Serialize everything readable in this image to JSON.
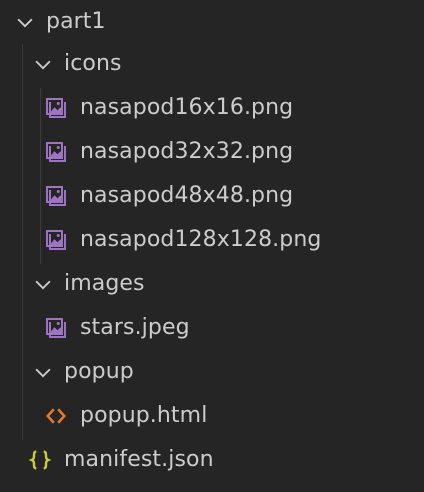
{
  "explorer": {
    "root": {
      "label": "part1",
      "expanded": true,
      "icon": "chevron-down-icon"
    },
    "icons_folder": {
      "label": "icons",
      "expanded": true,
      "icon": "chevron-down-icon"
    },
    "icon_files": [
      {
        "label": "nasapod16x16.png",
        "icon": "image-file-icon"
      },
      {
        "label": "nasapod32x32.png",
        "icon": "image-file-icon"
      },
      {
        "label": "nasapod48x48.png",
        "icon": "image-file-icon"
      },
      {
        "label": "nasapod128x128.png",
        "icon": "image-file-icon"
      }
    ],
    "images_folder": {
      "label": "images",
      "expanded": true,
      "icon": "chevron-down-icon"
    },
    "image_files": [
      {
        "label": "stars.jpeg",
        "icon": "image-file-icon"
      }
    ],
    "popup_folder": {
      "label": "popup",
      "expanded": true,
      "icon": "chevron-down-icon"
    },
    "popup_files": [
      {
        "label": "popup.html",
        "icon": "html-file-icon"
      }
    ],
    "manifest": {
      "label": "manifest.json",
      "icon": "json-braces-icon"
    }
  },
  "colors": {
    "background": "#252526",
    "text": "#cccccc",
    "image_icon": "#a074c4",
    "html_icon": "#e37933",
    "json_icon": "#cbcb41"
  }
}
